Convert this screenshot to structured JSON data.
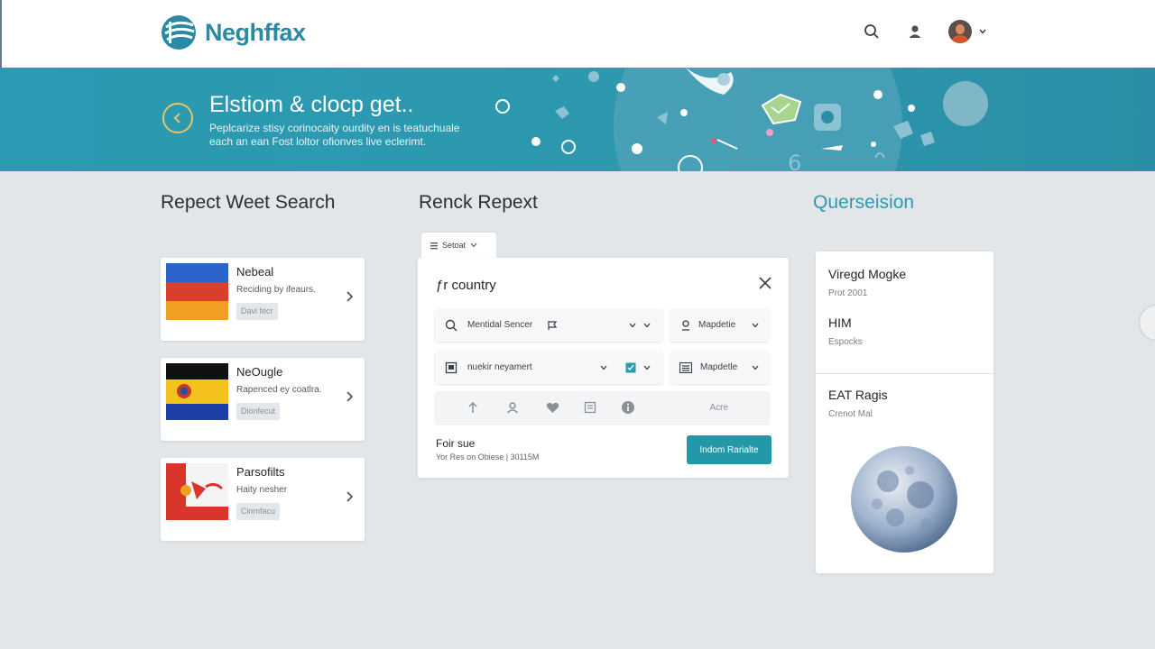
{
  "header": {
    "brand": "Neghffax",
    "icons": [
      "search-icon",
      "user-icon",
      "avatar",
      "chevron-down-icon"
    ]
  },
  "hero": {
    "title": "Elstiom & clocp get..",
    "subtitle": "Peplcarize stisy corinocaity ourdity en is teatuchuale each an ean Fost loltor ofionves live eclerimt."
  },
  "sections": {
    "left_title": "Repect Weet Search",
    "middle_title": "Renck Repext",
    "right_title": "Querseision"
  },
  "country_cards": [
    {
      "name": "Nebeal",
      "desc": "Reciding by ifeaurs.",
      "tag": "Davi fecr"
    },
    {
      "name": "NeOugle",
      "desc": "Rapenced ey coatlra.",
      "tag": "Dionfecut"
    },
    {
      "name": "Parsofilts",
      "desc": "Haity nesher",
      "tag": "Cinmfacu"
    }
  ],
  "middle_panel": {
    "tab_label": "Setoat",
    "title": "ƒr country",
    "field1": {
      "value": "Mentidal Sencer"
    },
    "field2": {
      "value": "Mapdetie"
    },
    "field3": {
      "value": "nuekir neyamert"
    },
    "field4": {
      "value": "Mapdetle"
    },
    "icon_row_label": "Acre",
    "footer_title": "Foir sue",
    "footer_sub": "Yor Res on Obiese | 30115M",
    "button": "Indom Rarialte"
  },
  "right_card": {
    "items": [
      {
        "title": "Viregd Mogke",
        "sub": "Prot 2001"
      },
      {
        "title": "HIM",
        "sub": "Espocks"
      },
      {
        "title": "EAT Ragis",
        "sub": "Crenot Mal"
      }
    ]
  },
  "colors": {
    "accent": "#2a9bb2",
    "button": "#2497a9",
    "hero_ring": "#e8c36a",
    "background": "#e3e6e9"
  }
}
